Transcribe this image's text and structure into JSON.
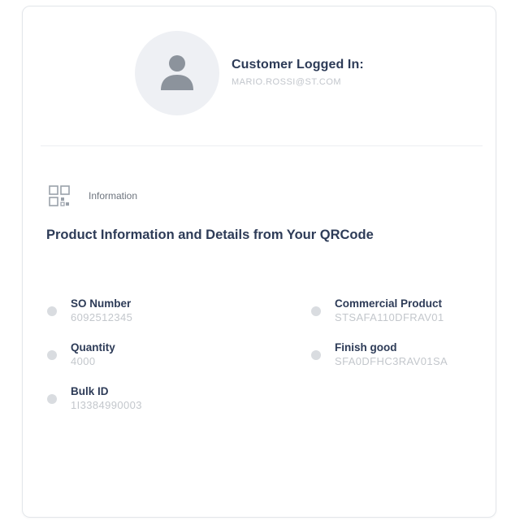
{
  "header": {
    "title": "Customer Logged In:",
    "email": "MARIO.ROSSI@ST.COM"
  },
  "section": {
    "label": "Information",
    "headline": "Product Information and Details from Your QRCode"
  },
  "fields": {
    "so_number": {
      "label": "SO Number",
      "value": "6092512345"
    },
    "quantity": {
      "label": "Quantity",
      "value": "4000"
    },
    "bulk_id": {
      "label": "Bulk ID",
      "value": "1I3384990003"
    },
    "commercial_product": {
      "label": "Commercial Product",
      "value": "STSAFA110DFRAV01"
    },
    "finish_good": {
      "label": "Finish good",
      "value": "SFA0DFHC3RAV01SA"
    }
  },
  "icons": {
    "avatar": "user-icon",
    "section": "grid-icon",
    "bullet": "dot-icon"
  },
  "colors": {
    "title": "#2d3b57",
    "muted": "#c3c7cc",
    "avatar_bg": "#eef0f4",
    "avatar_fg": "#8c939c"
  }
}
